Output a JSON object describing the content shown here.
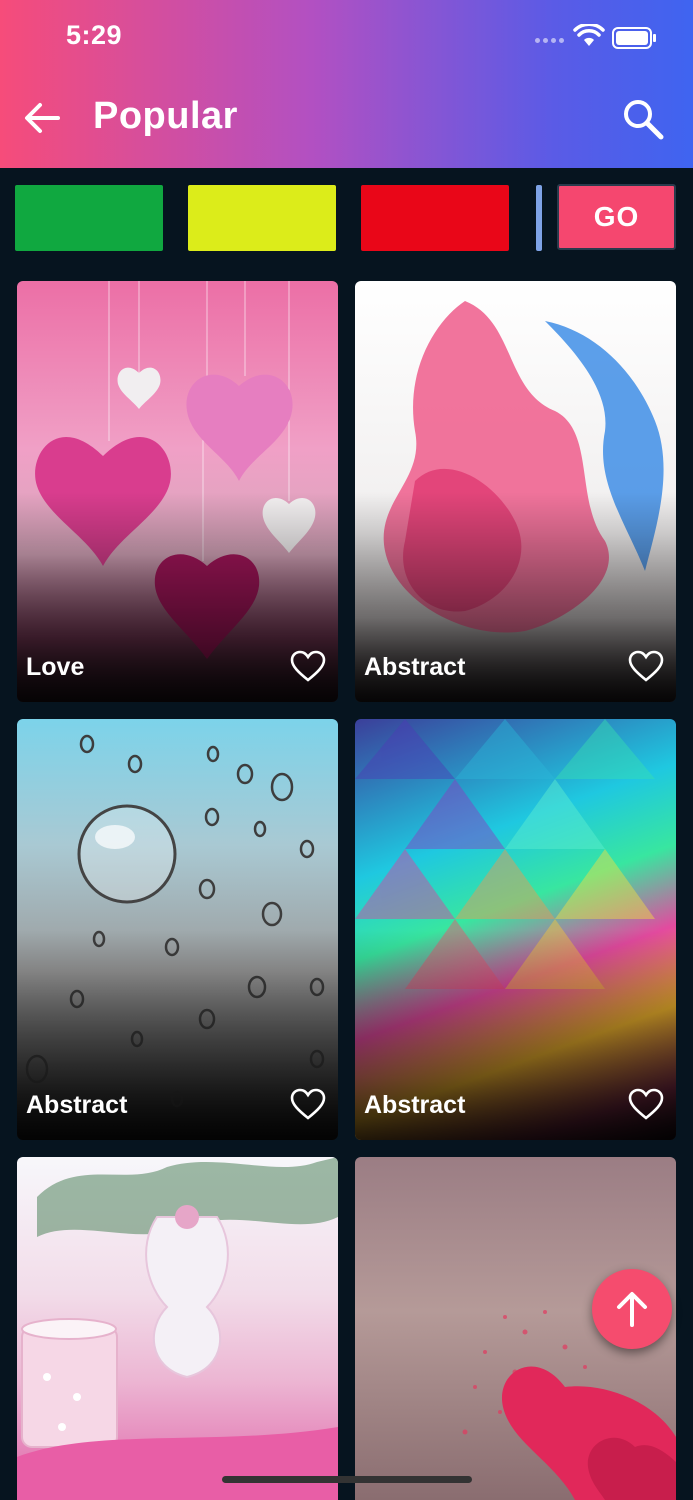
{
  "status_bar": {
    "time": "5:29"
  },
  "header": {
    "title": "Popular"
  },
  "filters": {
    "swatches": [
      {
        "name": "green",
        "color": "#10a840"
      },
      {
        "name": "yellow",
        "color": "#dcec1a"
      },
      {
        "name": "red",
        "color": "#e90618"
      }
    ],
    "go_label": "GO"
  },
  "wallpapers": [
    {
      "category": "Love",
      "favorited": false
    },
    {
      "category": "Abstract",
      "favorited": false
    },
    {
      "category": "Abstract",
      "favorited": false
    },
    {
      "category": "Abstract",
      "favorited": false
    },
    {
      "category": "",
      "favorited": false
    },
    {
      "category": "",
      "favorited": false
    }
  ],
  "colors": {
    "accent": "#f54c6e",
    "background": "#06141f"
  },
  "icons": {
    "back": "arrow-left-icon",
    "search": "search-icon",
    "favorite": "heart-outline-icon",
    "scroll_top": "arrow-up-icon"
  }
}
